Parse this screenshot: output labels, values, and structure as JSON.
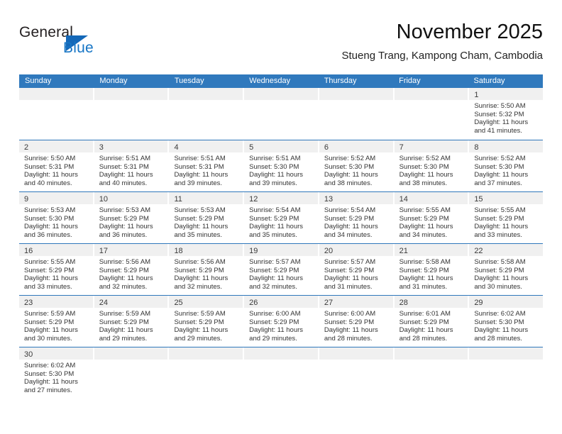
{
  "brand": {
    "line1": "General",
    "line2": "Blue",
    "accent_color": "#1468b8",
    "text_color": "#231f20"
  },
  "header": {
    "month_title": "November 2025",
    "location": "Stueng Trang, Kampong Cham, Cambodia"
  },
  "calendar": {
    "header_color": "#3079bd",
    "day_band_color": "#f0f0f0",
    "weekdays": [
      "Sunday",
      "Monday",
      "Tuesday",
      "Wednesday",
      "Thursday",
      "Friday",
      "Saturday"
    ],
    "weeks": [
      [
        {
          "empty": true
        },
        {
          "empty": true
        },
        {
          "empty": true
        },
        {
          "empty": true
        },
        {
          "empty": true
        },
        {
          "empty": true
        },
        {
          "day": "1",
          "sunrise": "Sunrise: 5:50 AM",
          "sunset": "Sunset: 5:32 PM",
          "daylight": "Daylight: 11 hours and 41 minutes."
        }
      ],
      [
        {
          "day": "2",
          "sunrise": "Sunrise: 5:50 AM",
          "sunset": "Sunset: 5:31 PM",
          "daylight": "Daylight: 11 hours and 40 minutes."
        },
        {
          "day": "3",
          "sunrise": "Sunrise: 5:51 AM",
          "sunset": "Sunset: 5:31 PM",
          "daylight": "Daylight: 11 hours and 40 minutes."
        },
        {
          "day": "4",
          "sunrise": "Sunrise: 5:51 AM",
          "sunset": "Sunset: 5:31 PM",
          "daylight": "Daylight: 11 hours and 39 minutes."
        },
        {
          "day": "5",
          "sunrise": "Sunrise: 5:51 AM",
          "sunset": "Sunset: 5:30 PM",
          "daylight": "Daylight: 11 hours and 39 minutes."
        },
        {
          "day": "6",
          "sunrise": "Sunrise: 5:52 AM",
          "sunset": "Sunset: 5:30 PM",
          "daylight": "Daylight: 11 hours and 38 minutes."
        },
        {
          "day": "7",
          "sunrise": "Sunrise: 5:52 AM",
          "sunset": "Sunset: 5:30 PM",
          "daylight": "Daylight: 11 hours and 38 minutes."
        },
        {
          "day": "8",
          "sunrise": "Sunrise: 5:52 AM",
          "sunset": "Sunset: 5:30 PM",
          "daylight": "Daylight: 11 hours and 37 minutes."
        }
      ],
      [
        {
          "day": "9",
          "sunrise": "Sunrise: 5:53 AM",
          "sunset": "Sunset: 5:30 PM",
          "daylight": "Daylight: 11 hours and 36 minutes."
        },
        {
          "day": "10",
          "sunrise": "Sunrise: 5:53 AM",
          "sunset": "Sunset: 5:29 PM",
          "daylight": "Daylight: 11 hours and 36 minutes."
        },
        {
          "day": "11",
          "sunrise": "Sunrise: 5:53 AM",
          "sunset": "Sunset: 5:29 PM",
          "daylight": "Daylight: 11 hours and 35 minutes."
        },
        {
          "day": "12",
          "sunrise": "Sunrise: 5:54 AM",
          "sunset": "Sunset: 5:29 PM",
          "daylight": "Daylight: 11 hours and 35 minutes."
        },
        {
          "day": "13",
          "sunrise": "Sunrise: 5:54 AM",
          "sunset": "Sunset: 5:29 PM",
          "daylight": "Daylight: 11 hours and 34 minutes."
        },
        {
          "day": "14",
          "sunrise": "Sunrise: 5:55 AM",
          "sunset": "Sunset: 5:29 PM",
          "daylight": "Daylight: 11 hours and 34 minutes."
        },
        {
          "day": "15",
          "sunrise": "Sunrise: 5:55 AM",
          "sunset": "Sunset: 5:29 PM",
          "daylight": "Daylight: 11 hours and 33 minutes."
        }
      ],
      [
        {
          "day": "16",
          "sunrise": "Sunrise: 5:55 AM",
          "sunset": "Sunset: 5:29 PM",
          "daylight": "Daylight: 11 hours and 33 minutes."
        },
        {
          "day": "17",
          "sunrise": "Sunrise: 5:56 AM",
          "sunset": "Sunset: 5:29 PM",
          "daylight": "Daylight: 11 hours and 32 minutes."
        },
        {
          "day": "18",
          "sunrise": "Sunrise: 5:56 AM",
          "sunset": "Sunset: 5:29 PM",
          "daylight": "Daylight: 11 hours and 32 minutes."
        },
        {
          "day": "19",
          "sunrise": "Sunrise: 5:57 AM",
          "sunset": "Sunset: 5:29 PM",
          "daylight": "Daylight: 11 hours and 32 minutes."
        },
        {
          "day": "20",
          "sunrise": "Sunrise: 5:57 AM",
          "sunset": "Sunset: 5:29 PM",
          "daylight": "Daylight: 11 hours and 31 minutes."
        },
        {
          "day": "21",
          "sunrise": "Sunrise: 5:58 AM",
          "sunset": "Sunset: 5:29 PM",
          "daylight": "Daylight: 11 hours and 31 minutes."
        },
        {
          "day": "22",
          "sunrise": "Sunrise: 5:58 AM",
          "sunset": "Sunset: 5:29 PM",
          "daylight": "Daylight: 11 hours and 30 minutes."
        }
      ],
      [
        {
          "day": "23",
          "sunrise": "Sunrise: 5:59 AM",
          "sunset": "Sunset: 5:29 PM",
          "daylight": "Daylight: 11 hours and 30 minutes."
        },
        {
          "day": "24",
          "sunrise": "Sunrise: 5:59 AM",
          "sunset": "Sunset: 5:29 PM",
          "daylight": "Daylight: 11 hours and 29 minutes."
        },
        {
          "day": "25",
          "sunrise": "Sunrise: 5:59 AM",
          "sunset": "Sunset: 5:29 PM",
          "daylight": "Daylight: 11 hours and 29 minutes."
        },
        {
          "day": "26",
          "sunrise": "Sunrise: 6:00 AM",
          "sunset": "Sunset: 5:29 PM",
          "daylight": "Daylight: 11 hours and 29 minutes."
        },
        {
          "day": "27",
          "sunrise": "Sunrise: 6:00 AM",
          "sunset": "Sunset: 5:29 PM",
          "daylight": "Daylight: 11 hours and 28 minutes."
        },
        {
          "day": "28",
          "sunrise": "Sunrise: 6:01 AM",
          "sunset": "Sunset: 5:29 PM",
          "daylight": "Daylight: 11 hours and 28 minutes."
        },
        {
          "day": "29",
          "sunrise": "Sunrise: 6:02 AM",
          "sunset": "Sunset: 5:30 PM",
          "daylight": "Daylight: 11 hours and 28 minutes."
        }
      ],
      [
        {
          "day": "30",
          "sunrise": "Sunrise: 6:02 AM",
          "sunset": "Sunset: 5:30 PM",
          "daylight": "Daylight: 11 hours and 27 minutes."
        },
        {
          "empty": true
        },
        {
          "empty": true
        },
        {
          "empty": true
        },
        {
          "empty": true
        },
        {
          "empty": true
        },
        {
          "empty": true
        }
      ]
    ]
  }
}
